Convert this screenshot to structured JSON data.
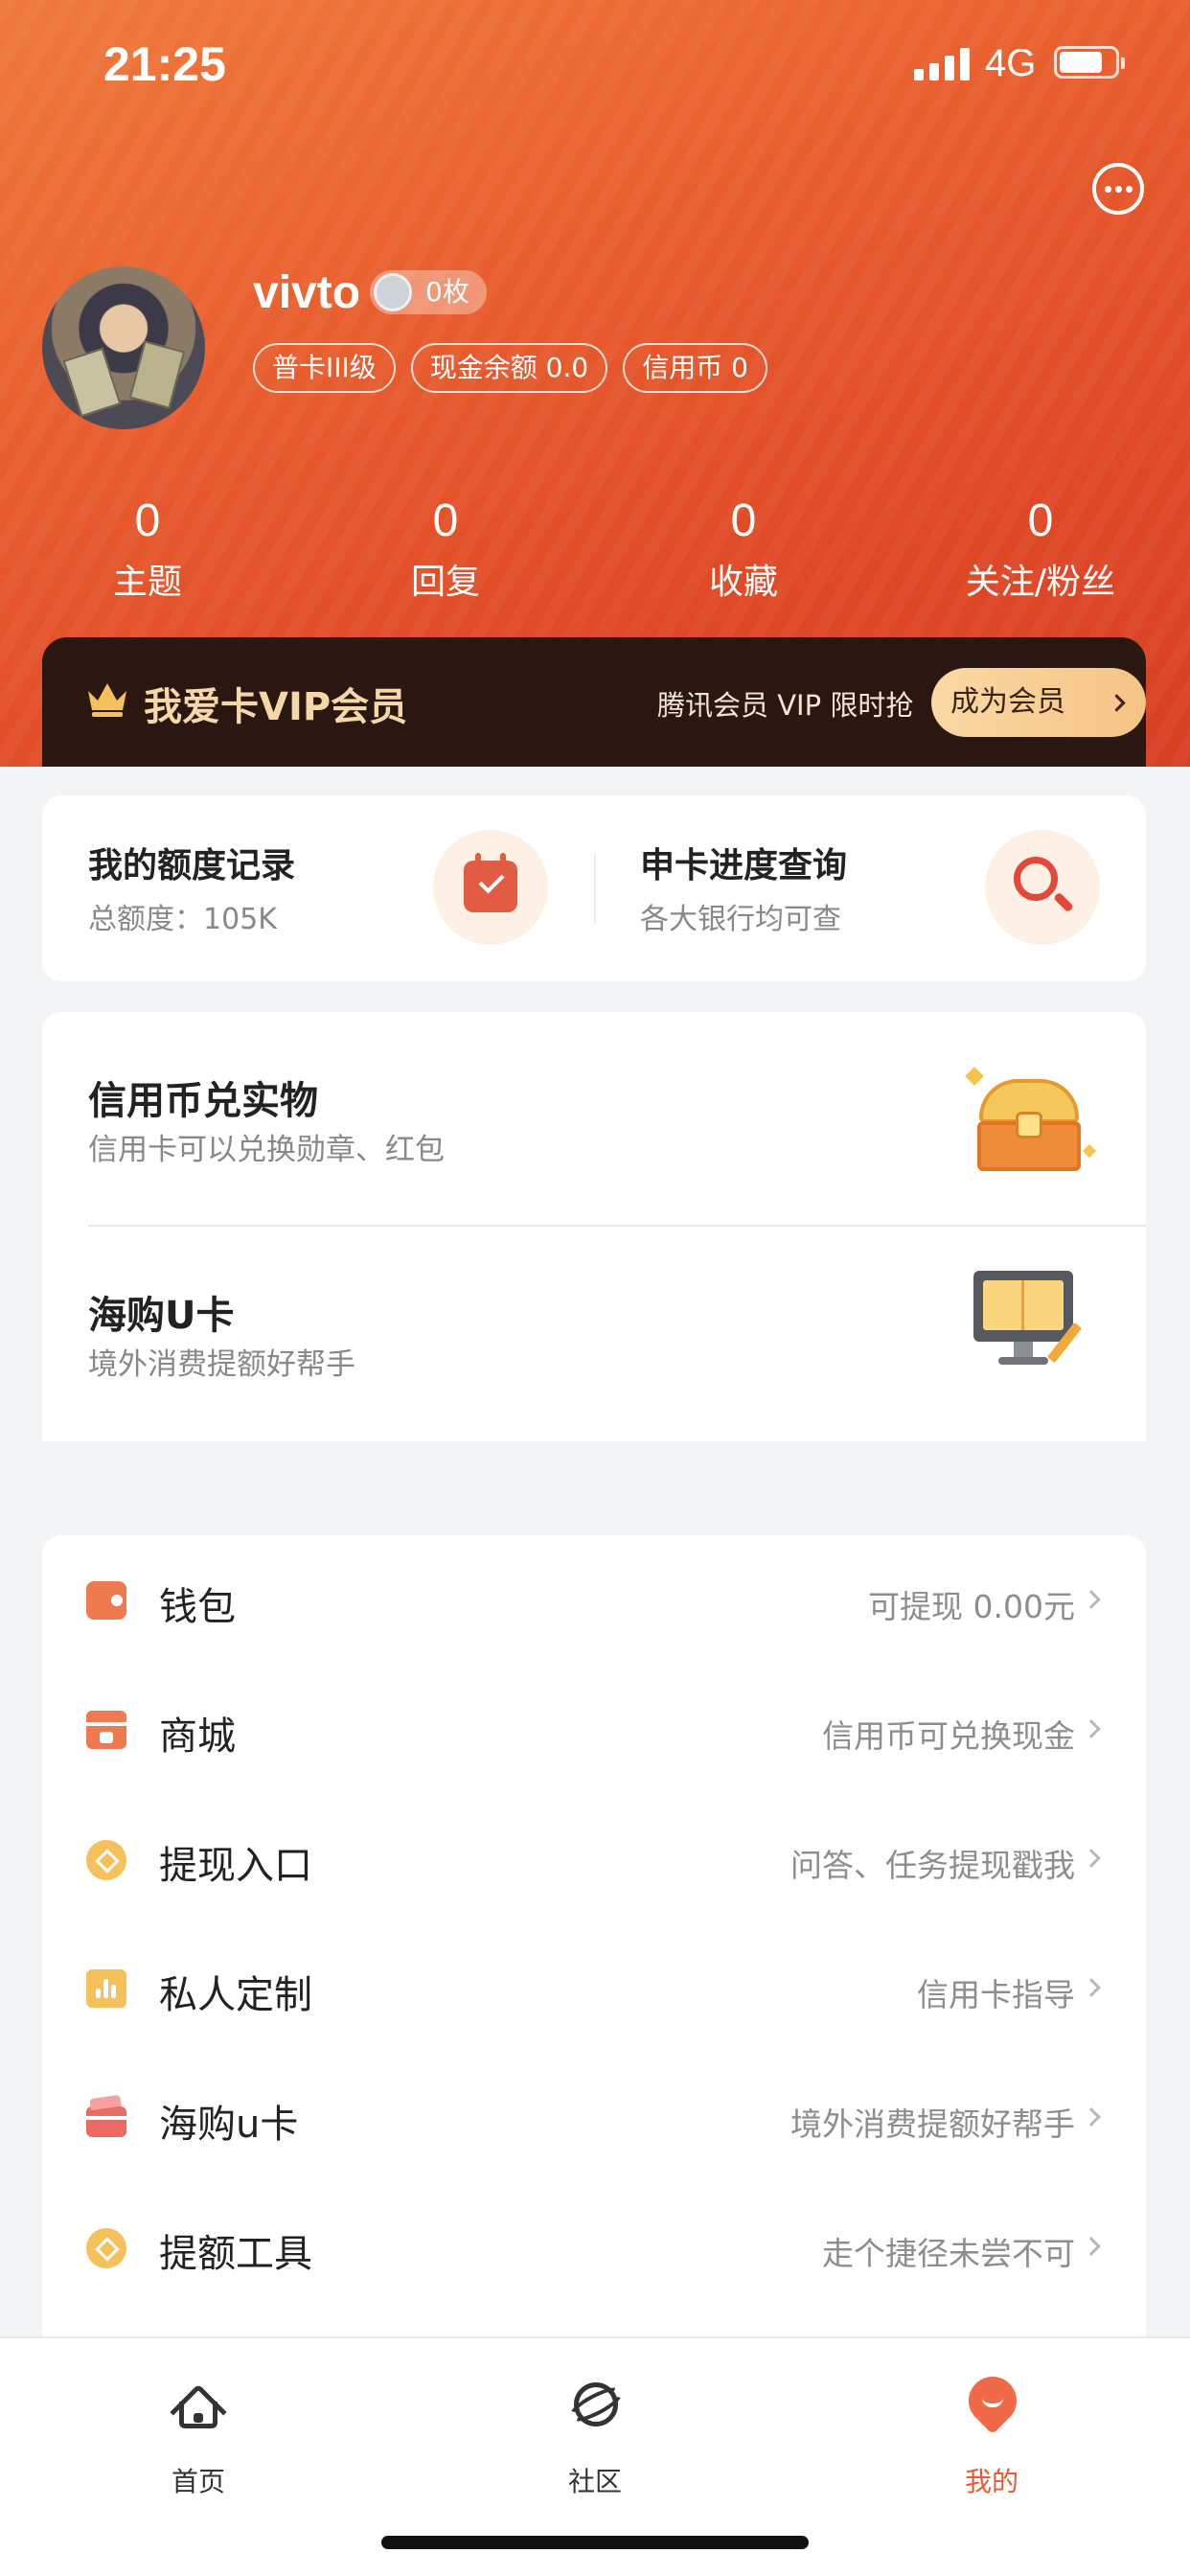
{
  "status_bar": {
    "time": "21:25",
    "network": "4G"
  },
  "profile": {
    "username": "vivto",
    "coin_badge": "0枚",
    "tags": [
      "普卡III级",
      "现金余额 0.0",
      "信用币 0"
    ]
  },
  "stats": [
    {
      "value": "0",
      "label": "主题"
    },
    {
      "value": "0",
      "label": "回复"
    },
    {
      "value": "0",
      "label": "收藏"
    },
    {
      "value": "0",
      "label": "关注/粉丝"
    }
  ],
  "vip": {
    "title": "我爱卡VIP会员",
    "subtitle": "腾讯会员 VIP 限时抢",
    "button": "成为会员"
  },
  "quick_actions": [
    {
      "title": "我的额度记录",
      "subtitle": "总额度：105K",
      "icon": "calendar-check-icon"
    },
    {
      "title": "申卡进度查询",
      "subtitle": "各大银行均可查",
      "icon": "magnifier-icon"
    }
  ],
  "promos": [
    {
      "title": "信用币兑实物",
      "subtitle": "信用卡可以兑换勋章、红包",
      "icon": "treasure-chest-icon"
    },
    {
      "title": "海购U卡",
      "subtitle": "境外消费提额好帮手",
      "icon": "monitor-book-icon"
    }
  ],
  "menu": [
    {
      "label": "钱包",
      "hint": "可提现 0.00元",
      "icon": "wallet-icon",
      "color": "#f07a4f"
    },
    {
      "label": "商城",
      "hint": "信用币可兑换现金",
      "icon": "shop-icon",
      "color": "#f07a4f"
    },
    {
      "label": "提现入口",
      "hint": "问答、任务提现戳我",
      "icon": "coin-icon",
      "color": "#f6c15a"
    },
    {
      "label": "私人定制",
      "hint": "信用卡指导",
      "icon": "bar-chart-icon",
      "color": "#f6c15a"
    },
    {
      "label": "海购u卡",
      "hint": "境外消费提额好帮手",
      "icon": "card-icon",
      "color": "#ea6a64"
    },
    {
      "label": "提额工具",
      "hint": "走个捷径未尝不可",
      "icon": "coin-icon",
      "color": "#f6c15a"
    }
  ],
  "tabbar": [
    {
      "label": "首页",
      "icon": "home-icon",
      "active": false
    },
    {
      "label": "社区",
      "icon": "planet-icon",
      "active": false
    },
    {
      "label": "我的",
      "icon": "me-icon",
      "active": true
    }
  ],
  "colors": {
    "accent": "#e85a37",
    "vip_bg": "#2a1712",
    "vip_gold": "#f6d7a8"
  }
}
